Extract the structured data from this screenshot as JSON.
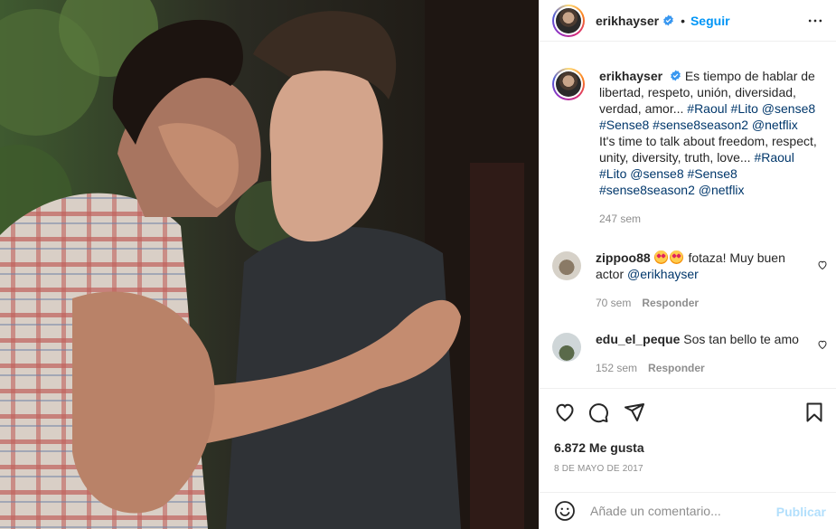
{
  "post": {
    "username": "erikhayser",
    "separator": "•",
    "follow_label": "Seguir",
    "more_icon": "more-horizontal-icon",
    "photo_alt": "two men kissing"
  },
  "caption": {
    "username": "erikhayser",
    "text_es": "Es tiempo de hablar de libertad, respeto, unión, diversidad, verdad, amor...",
    "tags_es": "#Raoul #Lito @sense8 #Sense8 #sense8season2 @netflix",
    "text_en": "It's time to talk about freedom, respect, unity, diversity, truth, love...",
    "tags_en": "#Raoul #Lito @sense8 #Sense8 #sense8season2 @netflix",
    "time": "247 sem"
  },
  "comments": [
    {
      "username": "zippoo88",
      "emoji": "heart-eyes-emoji",
      "text": "fotaza! Muy buen actor",
      "mention": "@erikhayser",
      "time": "70 sem",
      "reply_label": "Responder"
    },
    {
      "username": "edu_el_peque",
      "text": "Sos tan bello te amo",
      "time": "152 sem",
      "reply_label": "Responder"
    }
  ],
  "actions": {
    "like_icon": "heart-icon",
    "comment_icon": "comment-icon",
    "share_icon": "send-icon",
    "save_icon": "bookmark-icon"
  },
  "likes": "6.872 Me gusta",
  "date": "8 DE MAYO DE 2017",
  "add_comment": {
    "placeholder": "Añade un comentario...",
    "publish_label": "Publicar",
    "emoji_icon": "smile-icon"
  },
  "colors": {
    "link": "#00376b",
    "follow": "#0095f6",
    "muted": "#8e8e8e",
    "publish_disabled": "#b2dffc"
  }
}
